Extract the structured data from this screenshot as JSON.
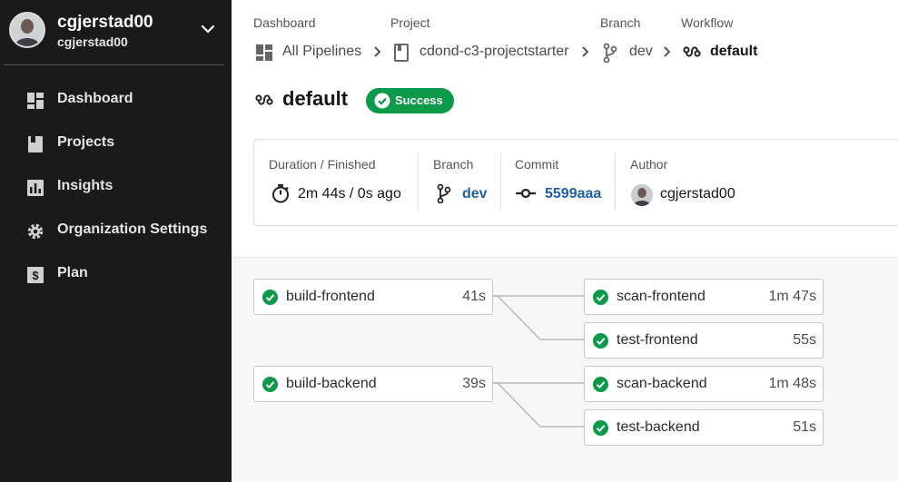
{
  "user": {
    "name": "cgjerstad00",
    "org": "cgjerstad00"
  },
  "nav": [
    {
      "label": "Dashboard",
      "icon": "dashboard-icon"
    },
    {
      "label": "Projects",
      "icon": "projects-icon"
    },
    {
      "label": "Insights",
      "icon": "insights-icon"
    },
    {
      "label": "Organization Settings",
      "icon": "gear-icon"
    },
    {
      "label": "Plan",
      "icon": "plan-icon"
    }
  ],
  "breadcrumb": {
    "dashboard": {
      "caption": "Dashboard",
      "label": "All Pipelines"
    },
    "project": {
      "caption": "Project",
      "label": "cdond-c3-projectstarter"
    },
    "branch": {
      "caption": "Branch",
      "label": "dev"
    },
    "workflow": {
      "caption": "Workflow",
      "label": "default"
    }
  },
  "workflow": {
    "title": "default",
    "status": "Success"
  },
  "summary": {
    "duration": {
      "caption": "Duration / Finished",
      "value": "2m 44s / 0s ago"
    },
    "branch": {
      "caption": "Branch",
      "value": "dev"
    },
    "commit": {
      "caption": "Commit",
      "value": "5599aaa"
    },
    "author": {
      "caption": "Author",
      "value": "cgjerstad00"
    }
  },
  "jobs": [
    {
      "name": "build-frontend",
      "time": "41s",
      "status": "success"
    },
    {
      "name": "scan-frontend",
      "time": "1m 47s",
      "status": "success"
    },
    {
      "name": "test-frontend",
      "time": "55s",
      "status": "success"
    },
    {
      "name": "build-backend",
      "time": "39s",
      "status": "success"
    },
    {
      "name": "scan-backend",
      "time": "1m 48s",
      "status": "success"
    },
    {
      "name": "test-backend",
      "time": "51s",
      "status": "success"
    }
  ],
  "colors": {
    "sidebar": "#1a1a1a",
    "success": "#0a9a4a",
    "link": "#1f5fa8"
  }
}
